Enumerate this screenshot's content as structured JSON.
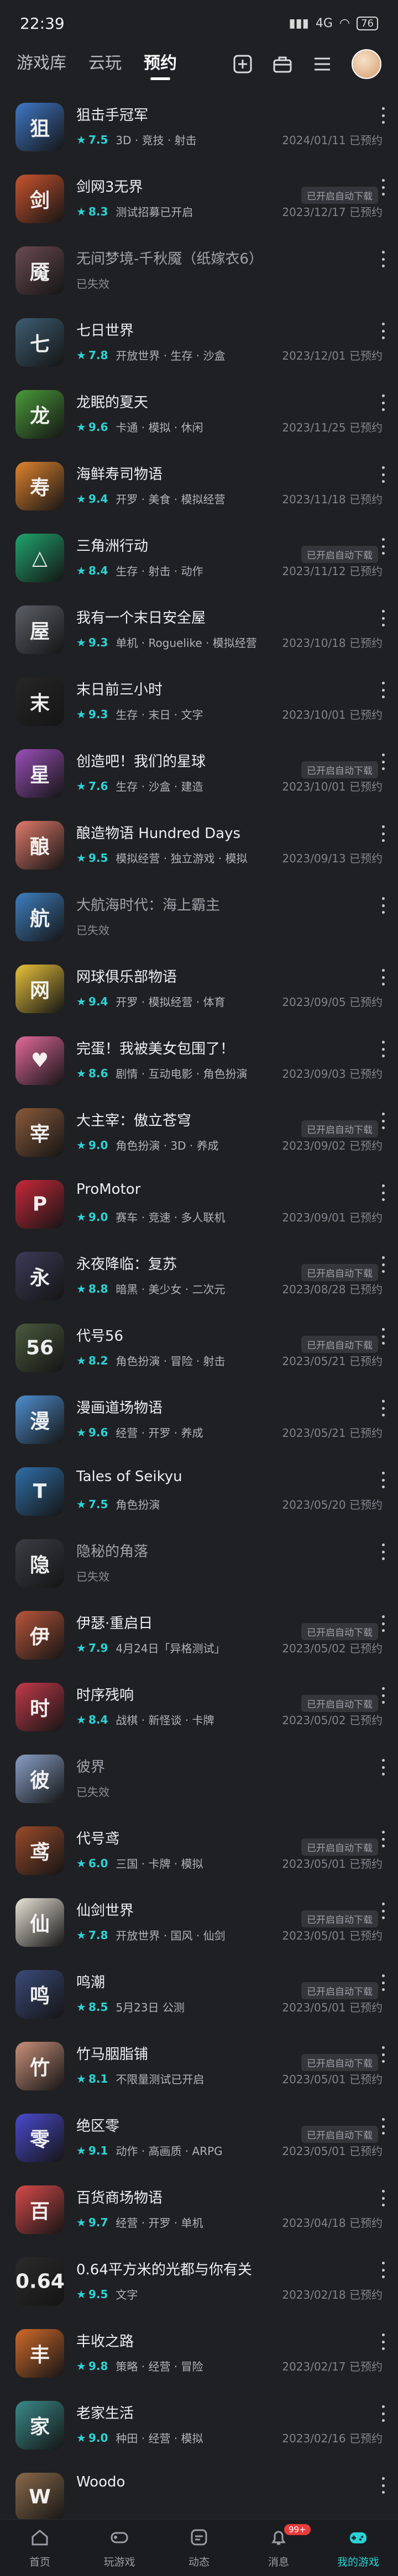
{
  "status": {
    "time": "22:39",
    "signal": "4G",
    "battery": "76"
  },
  "nav": {
    "tabs": [
      "游戏库",
      "云玩",
      "预约"
    ]
  },
  "games": [
    {
      "title": "狙击手冠军",
      "score": "7.5",
      "tags": "3D · 竞技 · 射击",
      "date": "2024/01/11 已预约",
      "color": "#3f78c8",
      "glyph": "狙"
    },
    {
      "title": "剑网3无界",
      "score": "8.3",
      "tags": "测试招募已开启",
      "date": "2023/12/17 已预约",
      "badge": "已开启自动下载",
      "color": "#c9542e",
      "glyph": "剑"
    },
    {
      "title": "无间梦境-千秋魇（纸嫁衣6）",
      "expired": "已失效",
      "color": "#6a4a52",
      "glyph": "魇"
    },
    {
      "title": "七日世界",
      "score": "7.8",
      "tags": "开放世界 · 生存 · 沙盒",
      "date": "2023/12/01 已预约",
      "color": "#3d5d72",
      "glyph": "七"
    },
    {
      "title": "龙眠的夏天",
      "score": "9.6",
      "tags": "卡通 · 模拟 · 休闲",
      "date": "2023/11/25 已预约",
      "color": "#4a9a3a",
      "glyph": "龙"
    },
    {
      "title": "海鲜寿司物语",
      "score": "9.4",
      "tags": "开罗 · 美食 · 模拟经营",
      "date": "2023/11/18 已预约",
      "color": "#e0832e",
      "glyph": "寿"
    },
    {
      "title": "三角洲行动",
      "score": "8.4",
      "tags": "生存 · 射击 · 动作",
      "date": "2023/11/12 已预约",
      "badge": "已开启自动下载",
      "color": "#1fa56e",
      "glyph": "△"
    },
    {
      "title": "我有一个末日安全屋",
      "score": "9.3",
      "tags": "单机 · Roguelike · 模拟经营",
      "date": "2023/10/18 已预约",
      "color": "#5b5f66",
      "glyph": "屋"
    },
    {
      "title": "末日前三小时",
      "score": "9.3",
      "tags": "生存 · 末日 · 文字",
      "date": "2023/10/01 已预约",
      "color": "#262626",
      "glyph": "末"
    },
    {
      "title": "创造吧！我们的星球",
      "score": "7.6",
      "tags": "生存 · 沙盒 · 建造",
      "date": "2023/10/01 已预约",
      "badge": "已开启自动下载",
      "color": "#9a4fb8",
      "glyph": "星"
    },
    {
      "title": "酿造物语 Hundred Days",
      "score": "9.5",
      "tags": "模拟经营 · 独立游戏 · 模拟",
      "date": "2023/09/13 已预约",
      "color": "#e07a6a",
      "glyph": "酿"
    },
    {
      "title": "大航海时代：海上霸主",
      "expired": "已失效",
      "color": "#3e7fbf",
      "glyph": "航"
    },
    {
      "title": "网球俱乐部物语",
      "score": "9.4",
      "tags": "开罗 · 模拟经营 · 体育",
      "date": "2023/09/05 已预约",
      "color": "#e8c23b",
      "glyph": "网"
    },
    {
      "title": "完蛋！我被美女包围了！",
      "score": "8.6",
      "tags": "剧情 · 互动电影 · 角色扮演",
      "date": "2023/09/03 已预约",
      "color": "#e46a9b",
      "glyph": "♥"
    },
    {
      "title": "大主宰：傲立苍穹",
      "score": "9.0",
      "tags": "角色扮演 · 3D · 养成",
      "date": "2023/09/02 已预约",
      "badge": "已开启自动下载",
      "color": "#8a5a3a",
      "glyph": "宰"
    },
    {
      "title": "ProMotor",
      "score": "9.0",
      "tags": "赛车 · 竞速 · 多人联机",
      "date": "2023/09/01 已预约",
      "color": "#c8283a",
      "glyph": "P"
    },
    {
      "title": "永夜降临：复苏",
      "score": "8.8",
      "tags": "暗黑 · 美少女 · 二次元",
      "date": "2023/08/28 已预约",
      "badge": "已开启自动下载",
      "color": "#3b3a58",
      "glyph": "永"
    },
    {
      "title": "代号56",
      "score": "8.2",
      "tags": "角色扮演 · 冒险 · 射击",
      "date": "2023/05/21 已预约",
      "badge": "已开启自动下载",
      "color": "#4a5a3e",
      "glyph": "56"
    },
    {
      "title": "漫画道场物语",
      "score": "9.6",
      "tags": "经营 · 开罗 · 养成",
      "date": "2023/05/21 已预约",
      "color": "#4f8fd0",
      "glyph": "漫"
    },
    {
      "title": "Tales of Seikyu",
      "score": "7.5",
      "tags": "角色扮演",
      "date": "2023/05/20 已预约",
      "color": "#2f6fa8",
      "glyph": "T"
    },
    {
      "title": "隐秘的角落",
      "expired": "已失效",
      "color": "#3a3d44",
      "glyph": "隐"
    },
    {
      "title": "伊瑟·重启日",
      "score": "7.9",
      "tags": "4月24日「异格测试」",
      "date": "2023/05/02 已预约",
      "badge": "已开启自动下载",
      "color": "#b8563a",
      "glyph": "伊"
    },
    {
      "title": "时序残响",
      "score": "8.4",
      "tags": "战棋 · 新怪谈 · 卡牌",
      "date": "2023/05/02 已预约",
      "badge": "已开启自动下载",
      "color": "#c33a4a",
      "glyph": "时"
    },
    {
      "title": "彼界",
      "expired": "已失效",
      "color": "#8aa0c8",
      "glyph": "彼"
    },
    {
      "title": "代号鸢",
      "score": "6.0",
      "tags": "三国 · 卡牌 · 模拟",
      "date": "2023/05/01 已预约",
      "badge": "已开启自动下载",
      "color": "#9a4a2a",
      "glyph": "鸢"
    },
    {
      "title": "仙剑世界",
      "score": "7.8",
      "tags": "开放世界 · 国风 · 仙剑",
      "date": "2023/05/01 已预约",
      "badge": "已开启自动下载",
      "color": "#e8e4d8",
      "glyph": "仙"
    },
    {
      "title": "鸣潮",
      "score": "8.5",
      "tags": "5月23日 公测",
      "date": "2023/05/01 已预约",
      "badge": "已开启自动下载",
      "color": "#3a4a7a",
      "glyph": "鸣"
    },
    {
      "title": "竹马胭脂铺",
      "score": "8.1",
      "tags": "不限量测试已开启",
      "date": "2023/05/01 已预约",
      "badge": "已开启自动下载",
      "color": "#c8907a",
      "glyph": "竹"
    },
    {
      "title": "绝区零",
      "score": "9.1",
      "tags": "动作 · 高画质 · ARPG",
      "date": "2023/05/01 已预约",
      "badge": "已开启自动下载",
      "color": "#4a4ad0",
      "glyph": "零"
    },
    {
      "title": "百货商场物语",
      "score": "9.7",
      "tags": "经营 · 开罗 · 单机",
      "date": "2023/04/18 已预约",
      "color": "#d84a4a",
      "glyph": "百"
    },
    {
      "title": "0.64平方米的光都与你有关",
      "score": "9.5",
      "tags": "文字",
      "date": "2023/02/18 已预约",
      "color": "#2a2a2a",
      "glyph": "0.64"
    },
    {
      "title": "丰收之路",
      "score": "9.8",
      "tags": "策略 · 经营 · 冒险",
      "date": "2023/02/17 已预约",
      "color": "#d06a2a",
      "glyph": "丰"
    },
    {
      "title": "老家生活",
      "score": "9.0",
      "tags": "种田 · 经营 · 模拟",
      "date": "2023/02/16 已预约",
      "color": "#3a8a8a",
      "glyph": "家"
    },
    {
      "title": "Woodo",
      "color": "#8a6a4a",
      "glyph": "W"
    }
  ],
  "bottom_nav": [
    {
      "label": "首页",
      "icon": "home-icon"
    },
    {
      "label": "玩游戏",
      "icon": "gamepad-icon"
    },
    {
      "label": "动态",
      "icon": "feed-icon"
    },
    {
      "label": "消息",
      "icon": "bell-icon",
      "badge": "99+"
    },
    {
      "label": "我的游戏",
      "icon": "my-games-icon",
      "active": true
    }
  ]
}
